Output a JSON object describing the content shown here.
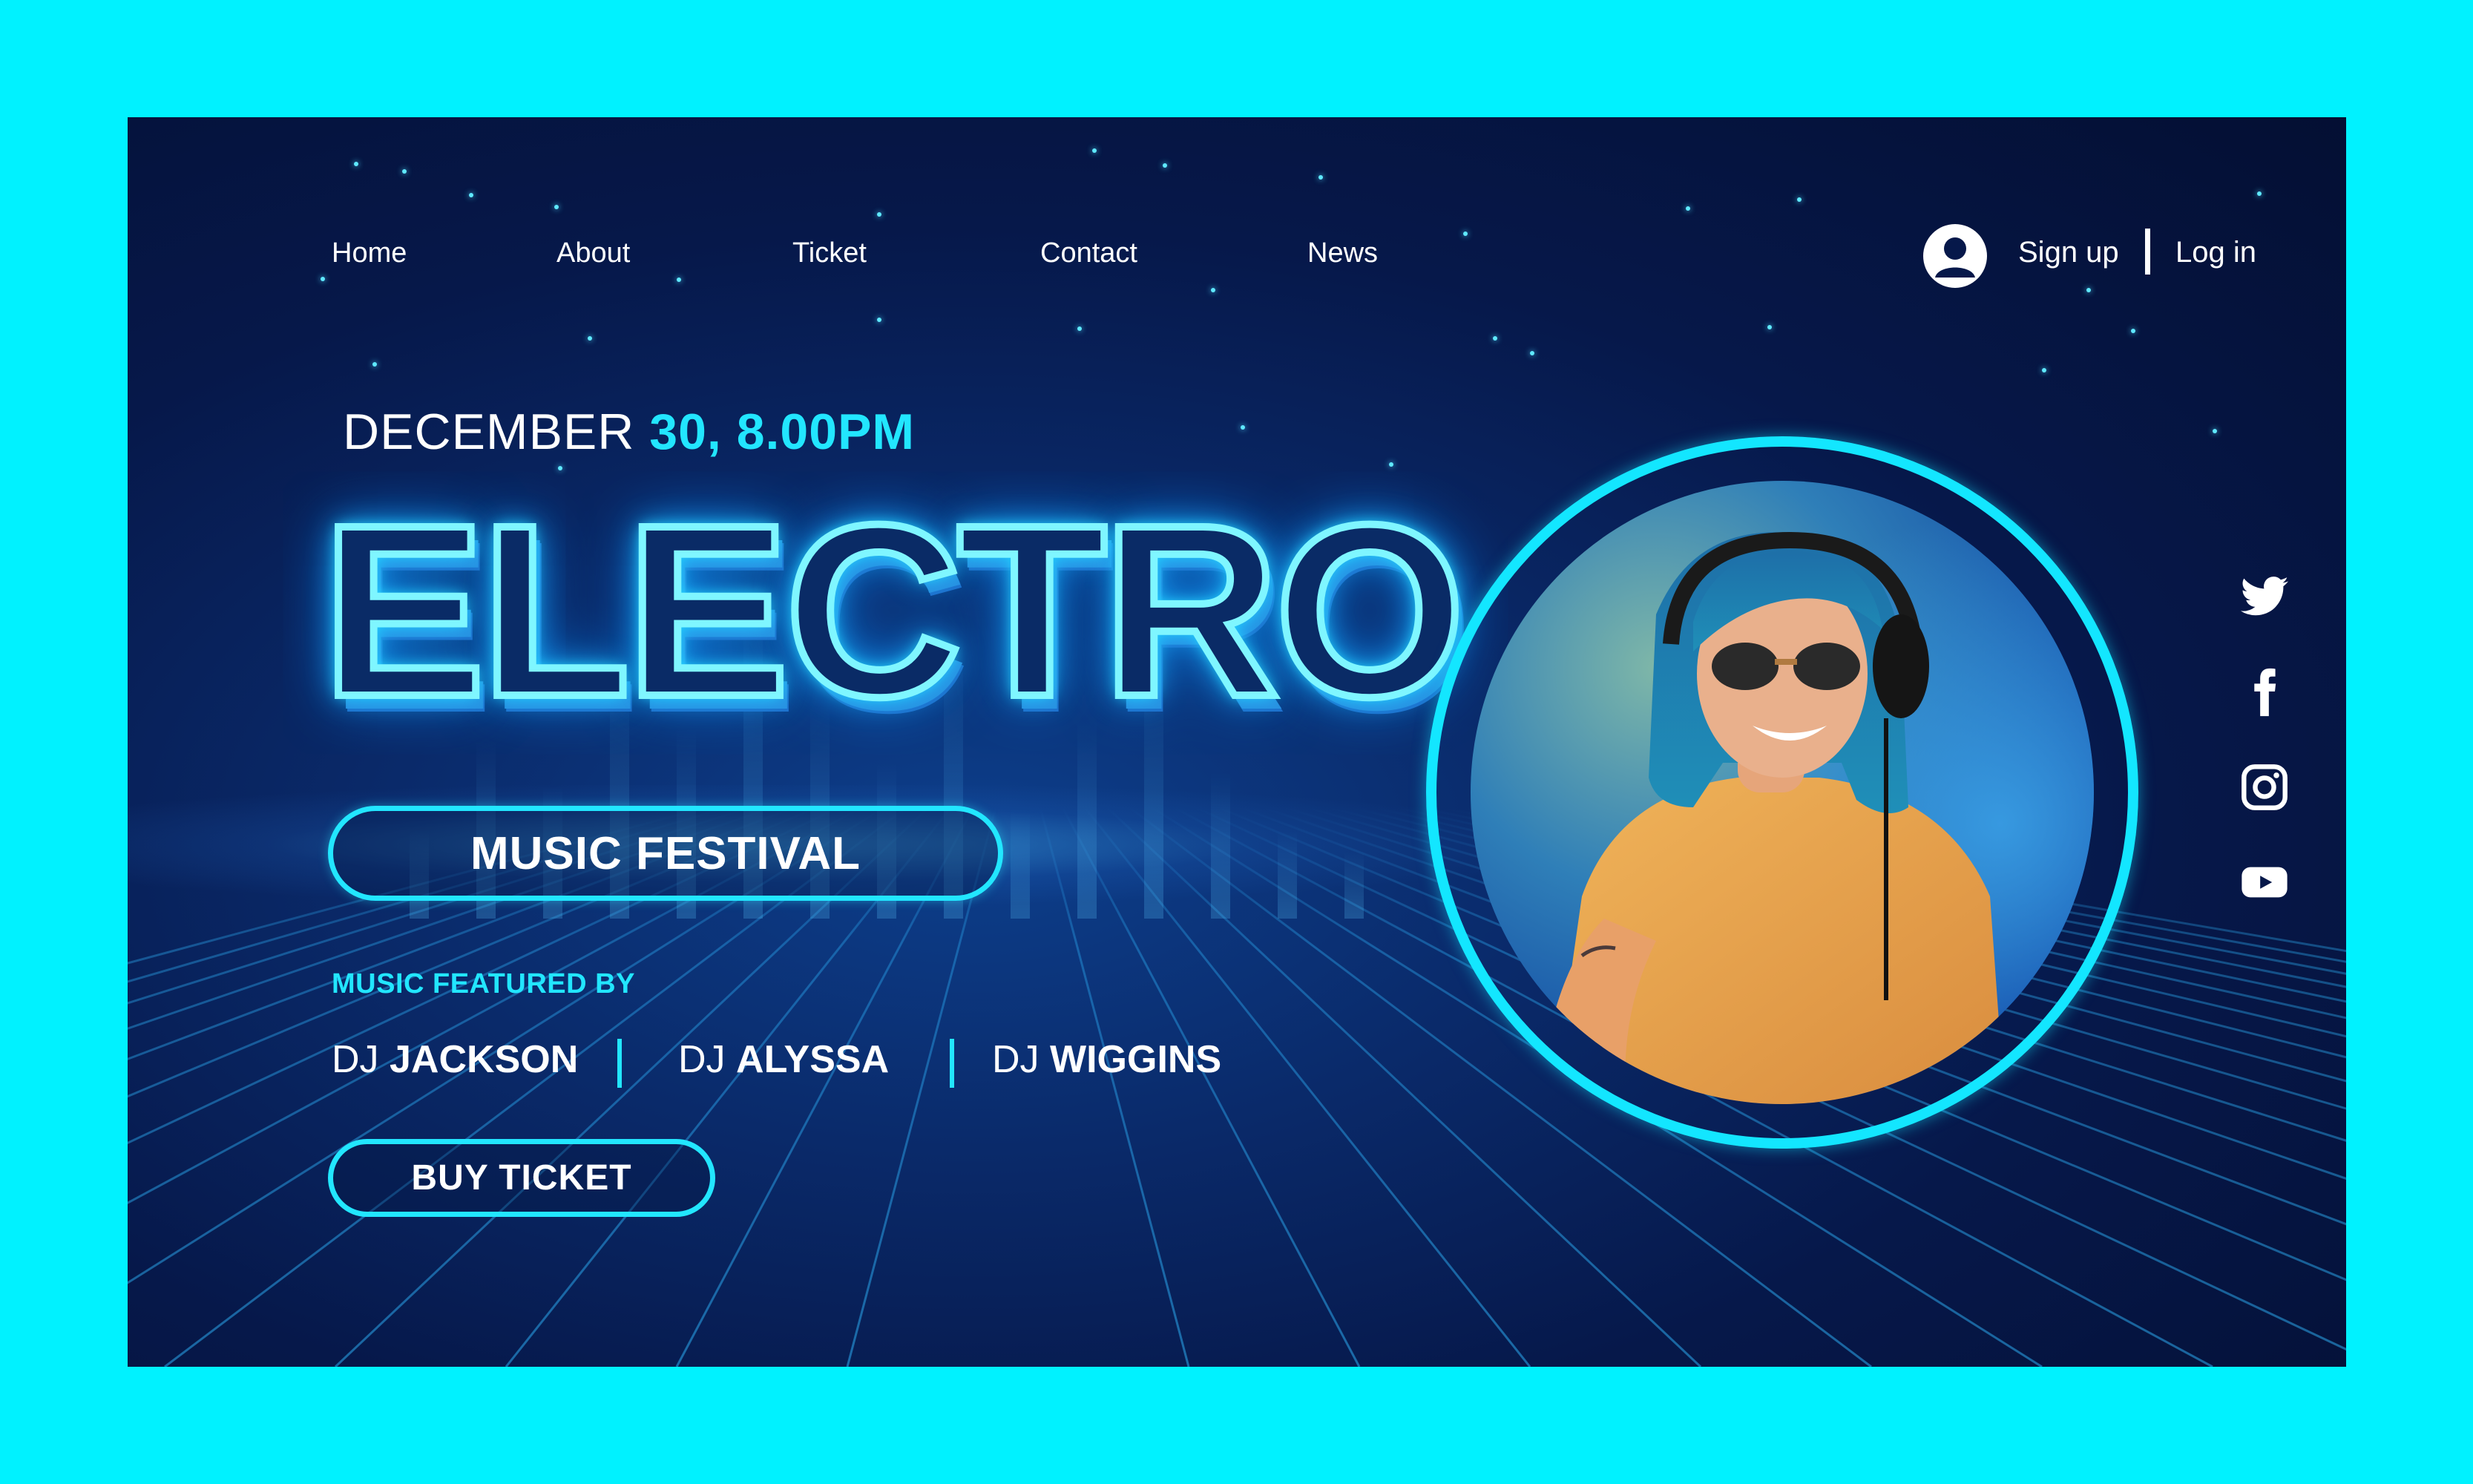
{
  "nav": {
    "home": "Home",
    "about": "About",
    "ticket": "Ticket",
    "contact": "Contact",
    "news": "News"
  },
  "auth": {
    "sign_up": "Sign up",
    "log_in": "Log in"
  },
  "hero": {
    "date_prefix": "DECEMBER",
    "date_accent": "30, 8.00PM",
    "title": "ELECTRO",
    "subtitle": "MUSIC FESTIVAL",
    "featured_label": "MUSIC FEATURED BY",
    "djs": [
      {
        "prefix": "DJ",
        "name": "JACKSON"
      },
      {
        "prefix": "DJ",
        "name": "ALYSSA"
      },
      {
        "prefix": "DJ",
        "name": "WIGGINS"
      }
    ],
    "cta": "BUY TICKET"
  },
  "social": [
    "twitter-icon",
    "facebook-icon",
    "instagram-icon",
    "youtube-icon"
  ],
  "colors": {
    "accent": "#22E6FF",
    "background_outer": "#00F2FF",
    "background_inner": "#06184A",
    "text": "#FFFFFF"
  }
}
